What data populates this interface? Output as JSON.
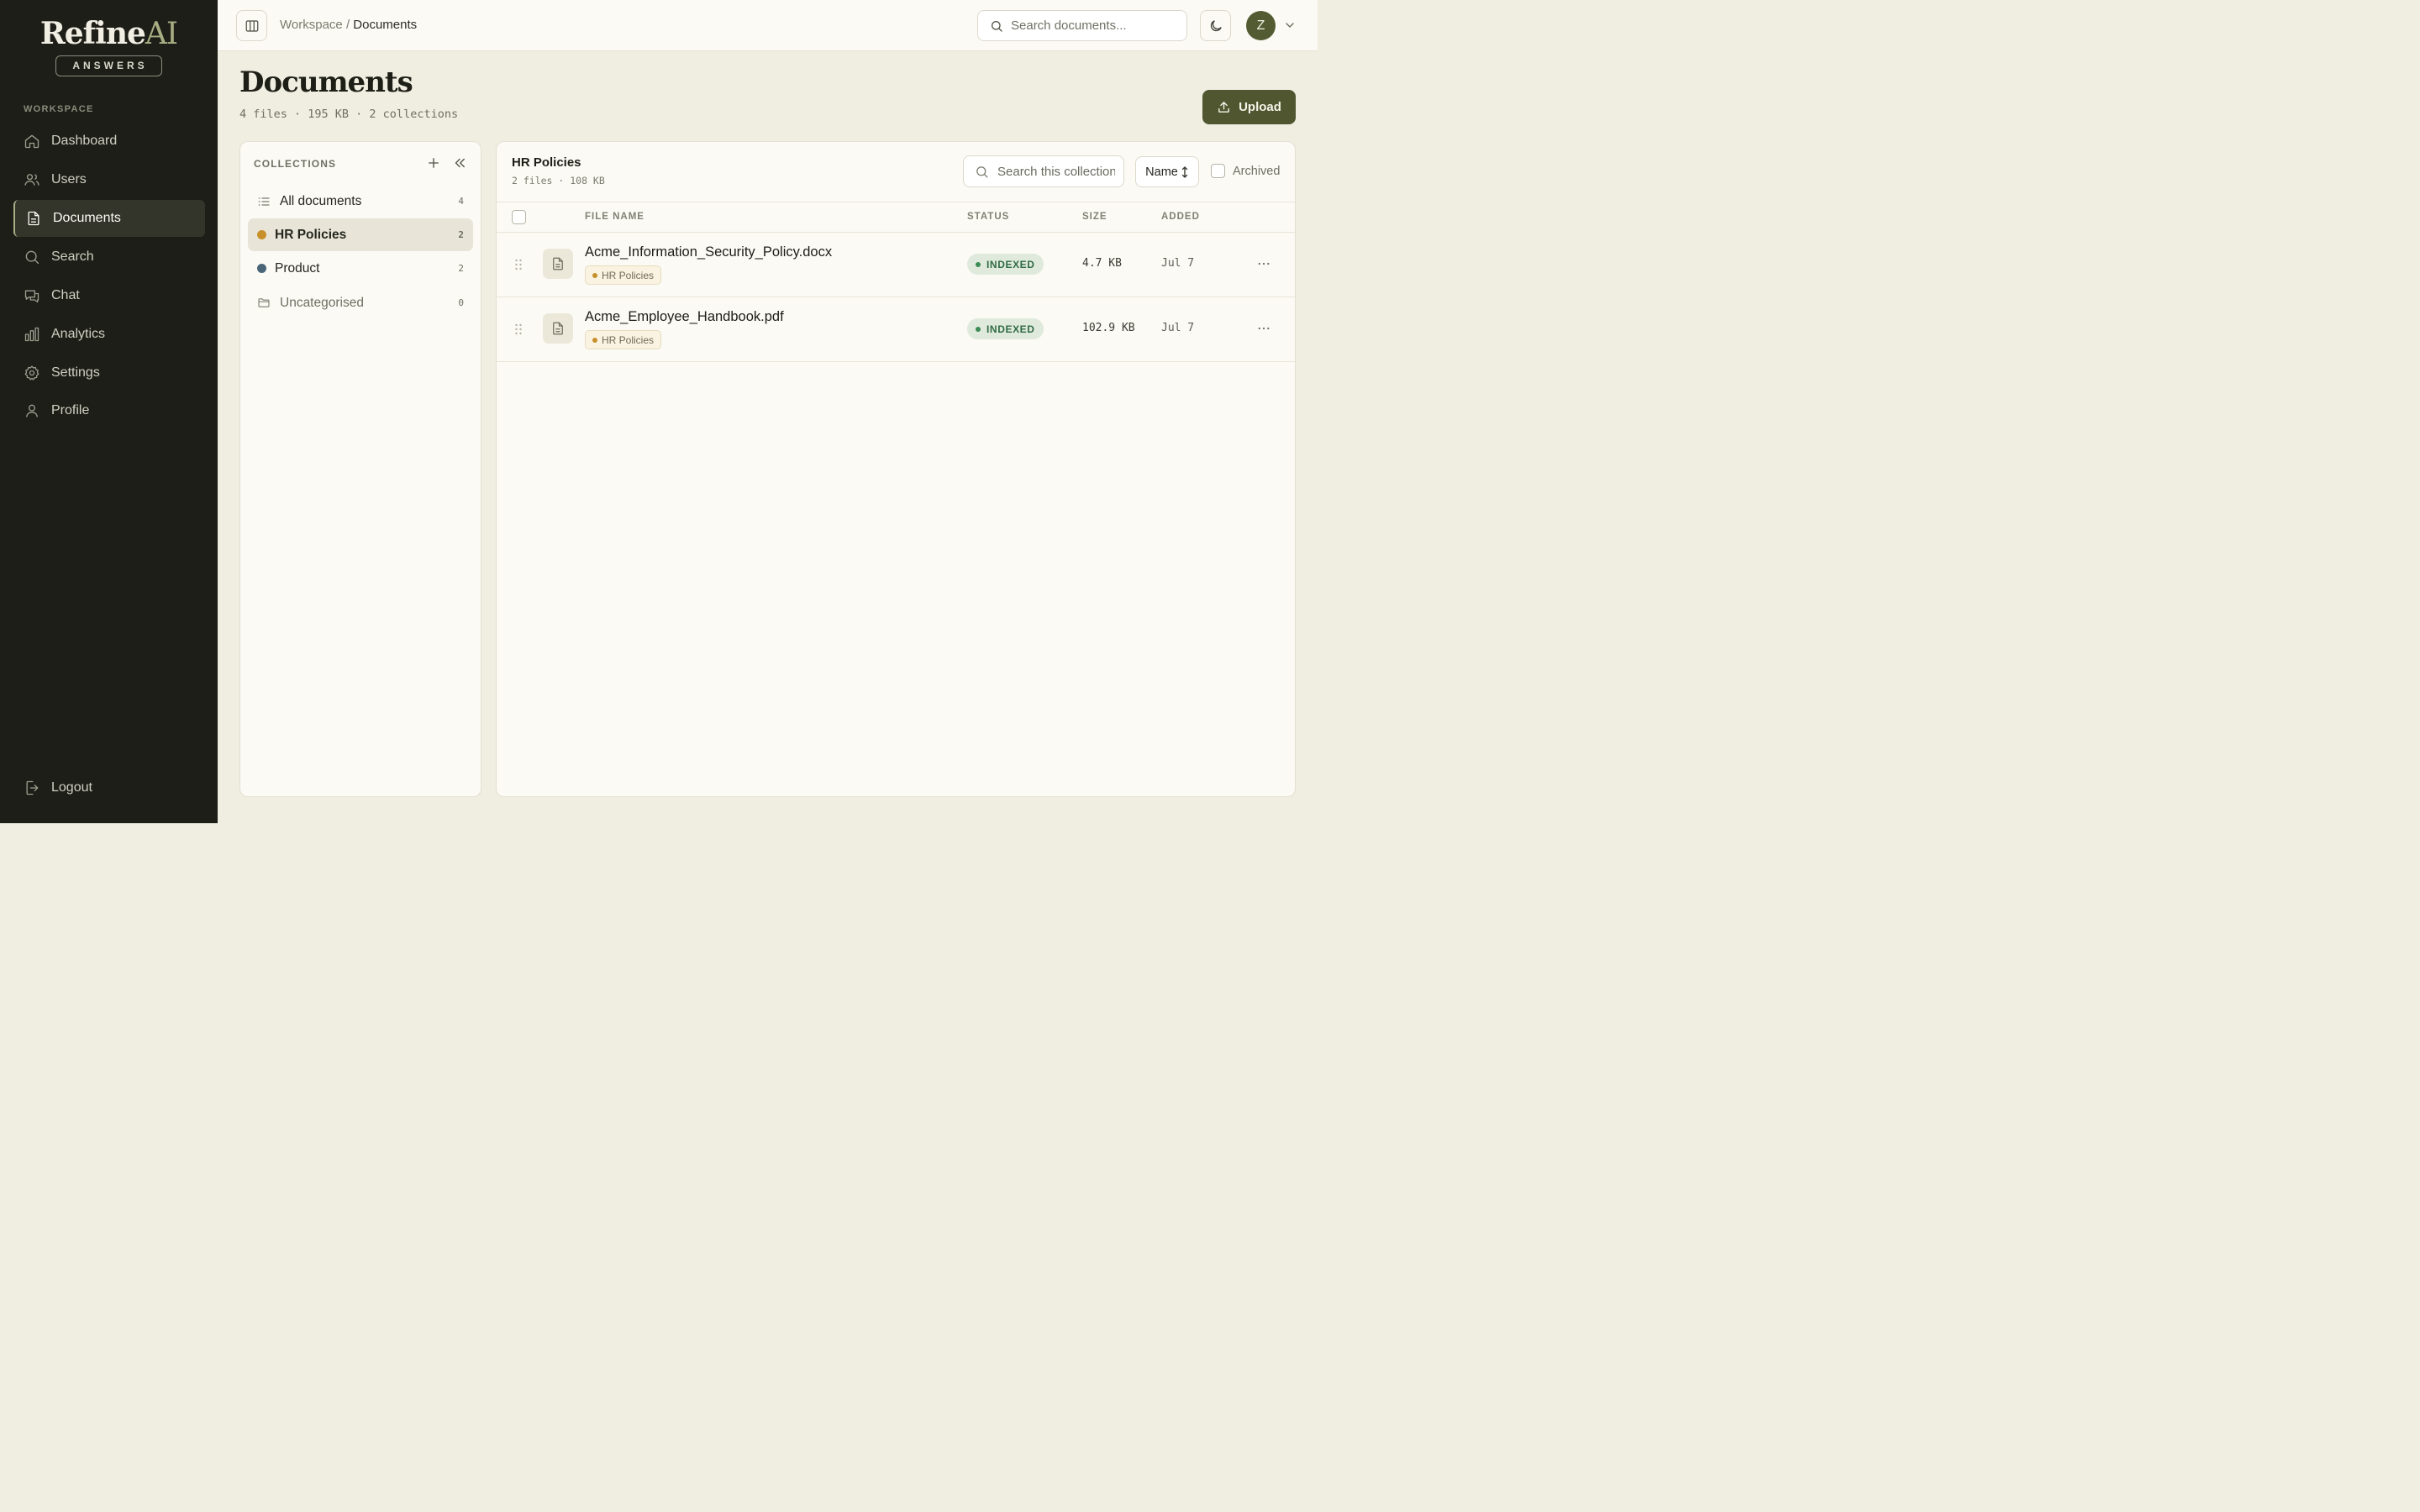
{
  "app": {
    "logo_main": "Refine",
    "logo_accent": "AI",
    "logo_badge": "ANSWERS"
  },
  "sidebar": {
    "section_label": "WORKSPACE",
    "items": [
      {
        "label": "Dashboard",
        "icon": "home-icon"
      },
      {
        "label": "Users",
        "icon": "users-icon"
      },
      {
        "label": "Documents",
        "icon": "document-icon",
        "active": true
      },
      {
        "label": "Search",
        "icon": "search-icon"
      },
      {
        "label": "Chat",
        "icon": "chat-icon"
      },
      {
        "label": "Analytics",
        "icon": "bar-chart-icon"
      },
      {
        "label": "Settings",
        "icon": "gear-icon"
      },
      {
        "label": "Profile",
        "icon": "user-icon"
      }
    ],
    "logout_label": "Logout"
  },
  "topbar": {
    "breadcrumb_root": "Workspace",
    "breadcrumb_sep": "/",
    "breadcrumb_current": "Documents",
    "search_placeholder": "Search documents...",
    "avatar_initial": "Z"
  },
  "page": {
    "title": "Documents",
    "subtitle": "4 files · 195 KB · 2 collections",
    "upload_label": "Upload"
  },
  "collections": {
    "header": "COLLECTIONS",
    "items": [
      {
        "label": "All documents",
        "count": "4",
        "icon": "list-icon"
      },
      {
        "label": "HR Policies",
        "count": "2",
        "color": "#c8902b",
        "active": true
      },
      {
        "label": "Product",
        "count": "2",
        "color": "#4a6577"
      },
      {
        "label": "Uncategorised",
        "count": "0",
        "icon": "folder-icon"
      }
    ]
  },
  "files": {
    "title": "HR Policies",
    "subtitle": "2 files · 108 KB",
    "search_placeholder": "Search this collection",
    "sort_label": "Name",
    "archived_label": "Archived",
    "columns": [
      "FILE NAME",
      "STATUS",
      "SIZE",
      "ADDED"
    ],
    "rows": [
      {
        "name": "Acme_Information_Security_Policy.docx",
        "tag": "HR Policies",
        "status": "INDEXED",
        "size": "4.7 KB",
        "added": "Jul 7"
      },
      {
        "name": "Acme_Employee_Handbook.pdf",
        "tag": "HR Policies",
        "status": "INDEXED",
        "size": "102.9 KB",
        "added": "Jul 7"
      }
    ]
  },
  "colors": {
    "sidebar_bg": "#1d1e17",
    "page_bg": "#f0ede1",
    "accent": "#4f5630",
    "status_green": "#2f6b43"
  }
}
